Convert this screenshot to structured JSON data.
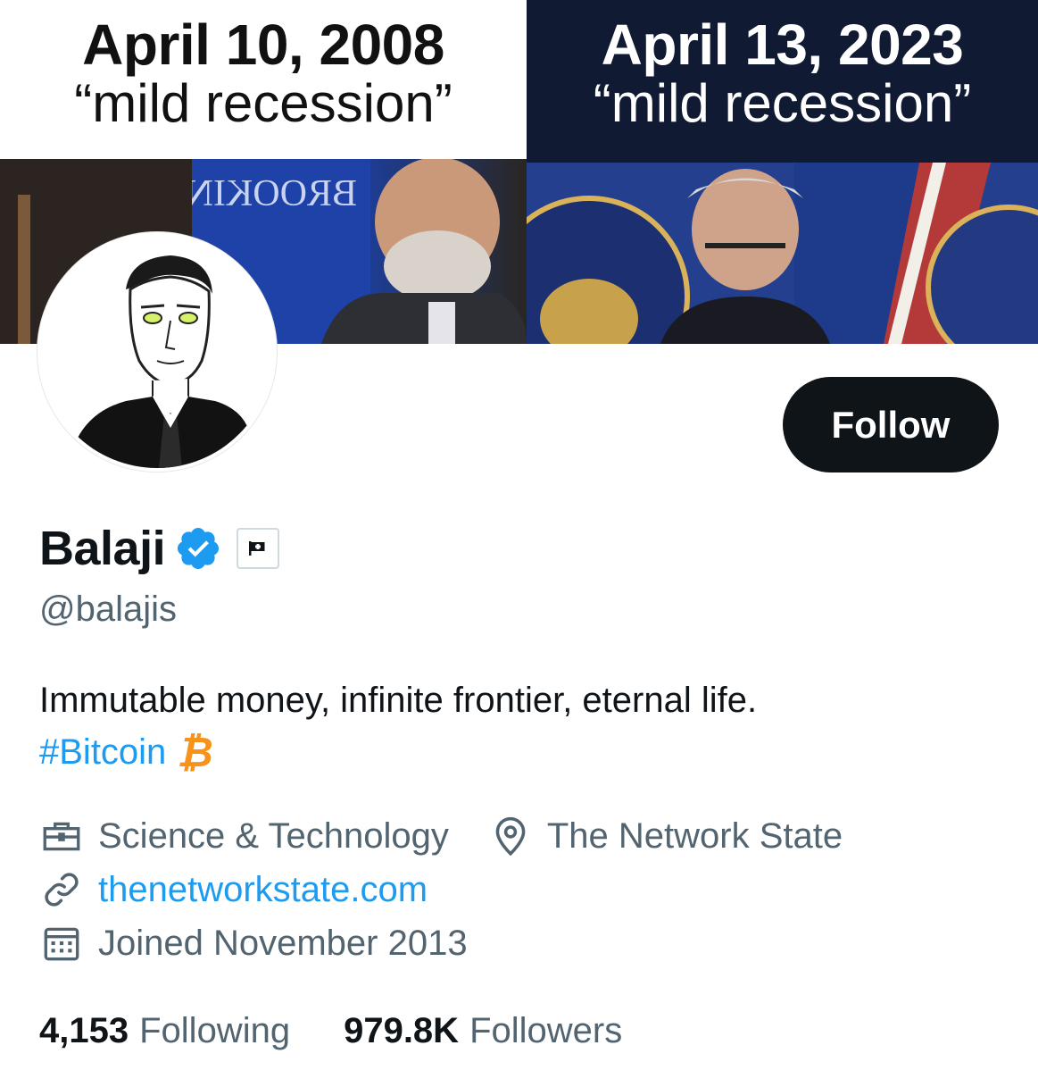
{
  "banner": {
    "left": {
      "date": "April 10, 2008",
      "quote": "“mild recession”"
    },
    "right": {
      "date": "April 13, 2023",
      "quote": "“mild recession”"
    }
  },
  "follow_button": {
    "label": "Follow"
  },
  "profile": {
    "name": "Balaji",
    "handle": "@balajis",
    "bio_line1": "Immutable money, infinite frontier, eternal life.",
    "bio_hashtag": "#Bitcoin",
    "bio_emoji": "₿"
  },
  "meta": {
    "category": "Science & Technology",
    "location": "The Network State",
    "website": "thenetworkstate.com",
    "joined": "Joined November 2013"
  },
  "stats": {
    "following_count": "4,153",
    "following_label": "Following",
    "followers_count": "979.8K",
    "followers_label": "Followers"
  },
  "colors": {
    "accent": "#1d9bf0",
    "text_primary": "#0f1419",
    "text_secondary": "#536471",
    "bitcoin": "#f7931a",
    "banner_right_bg": "#101a33"
  },
  "icons": [
    "verified-badge-icon",
    "flag-icon",
    "briefcase-icon",
    "location-pin-icon",
    "link-icon",
    "calendar-icon"
  ]
}
